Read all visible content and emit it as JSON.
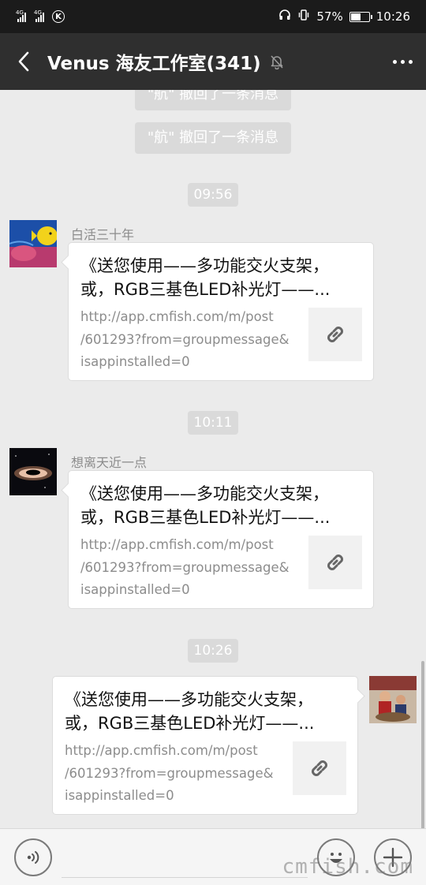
{
  "status_bar": {
    "signal1_label": "4G",
    "signal2_label": "4G",
    "carrier_badge": "K",
    "battery_percent": "57%",
    "battery_level": 0.57,
    "time": "10:26",
    "icons": [
      "headset-icon",
      "vibrate-icon",
      "battery-icon"
    ]
  },
  "header": {
    "title": "Venus 海友工作室(341)",
    "icons": [
      "back-icon",
      "mute-bell-icon",
      "more-icon"
    ]
  },
  "chat": {
    "system_notes": [
      "\"航\" 撤回了一条消息",
      "\"航\" 撤回了一条消息"
    ],
    "times": [
      "09:56",
      "10:11",
      "10:26"
    ],
    "messages": [
      {
        "sender": "白活三十年",
        "title_line1": "《送您使用——多功能交火支架，",
        "title_line2": "或，RGB三基色LED补光灯——...",
        "url_line1": "http://app.cmfish.com/m/post",
        "url_line2": "/601293?from=groupmessage&",
        "url_line3": "isappinstalled=0",
        "side": "left"
      },
      {
        "sender": "想离天近一点",
        "title_line1": "《送您使用——多功能交火支架，",
        "title_line2": "或，RGB三基色LED补光灯——...",
        "url_line1": "http://app.cmfish.com/m/post",
        "url_line2": "/601293?from=groupmessage&",
        "url_line3": "isappinstalled=0",
        "side": "left"
      },
      {
        "sender": "",
        "title_line1": "《送您使用——多功能交火支架，",
        "title_line2": "或，RGB三基色LED补光灯——...",
        "url_line1": "http://app.cmfish.com/m/post",
        "url_line2": "/601293?from=groupmessage&",
        "url_line3": "isappinstalled=0",
        "side": "right"
      }
    ]
  },
  "input_bar": {
    "icons": [
      "voice-icon",
      "emoji-icon",
      "plus-icon"
    ],
    "input_value": ""
  },
  "watermark": "cmfish.com",
  "colors": {
    "status_bar_bg": "#1b1b1b",
    "header_bg": "#2f2f2f",
    "chat_bg": "#ebebeb",
    "chip_bg": "#dadada",
    "link_gray": "#8c8c8c"
  }
}
